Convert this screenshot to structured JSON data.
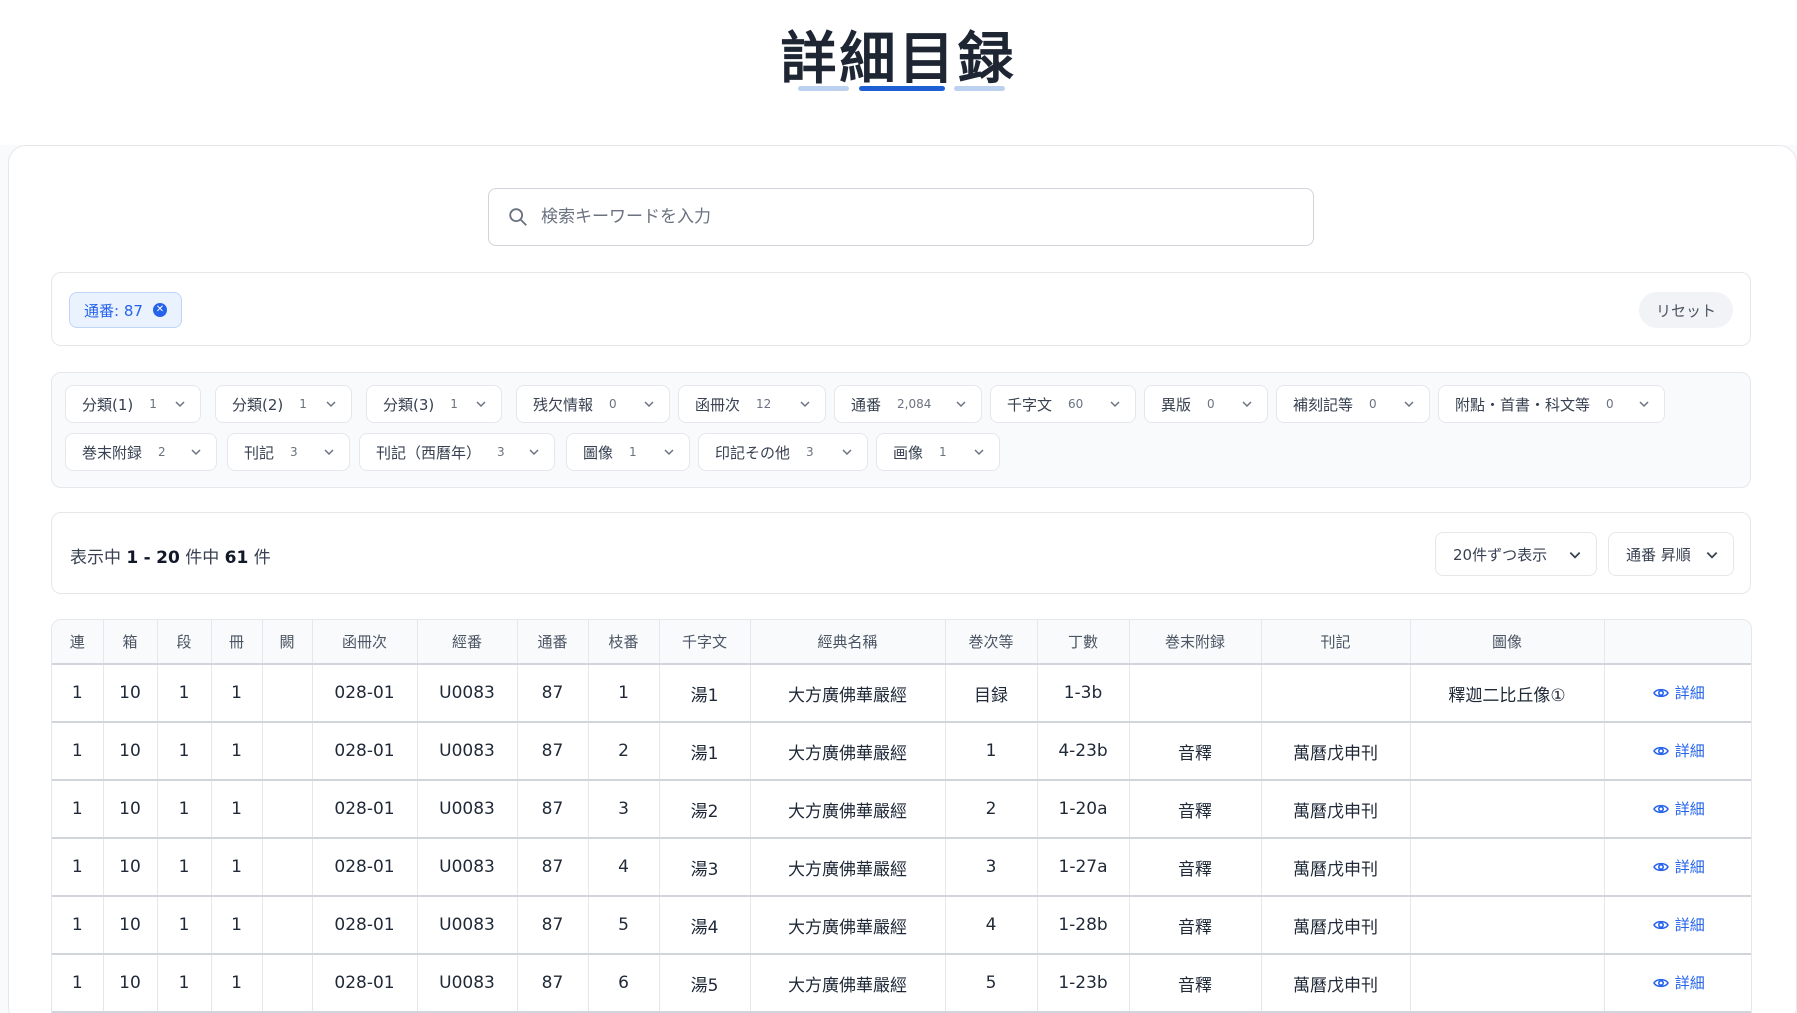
{
  "header": {
    "title": "詳細目録"
  },
  "search": {
    "placeholder": "検索キーワードを入力",
    "value": ""
  },
  "active_filters": {
    "chip_label": "通番: 87",
    "reset_label": "リセット"
  },
  "facets": [
    {
      "label": "分類(1)",
      "count": "1"
    },
    {
      "label": "分類(2)",
      "count": "1"
    },
    {
      "label": "分類(3)",
      "count": "1"
    },
    {
      "label": "残欠情報",
      "count": "0"
    },
    {
      "label": "函冊次",
      "count": "12"
    },
    {
      "label": "通番",
      "count": "2,084"
    },
    {
      "label": "千字文",
      "count": "60"
    },
    {
      "label": "異版",
      "count": "0"
    },
    {
      "label": "補刻記等",
      "count": "0"
    },
    {
      "label": "附點・首書・科文等",
      "count": "0"
    },
    {
      "label": "巻末附録",
      "count": "2"
    },
    {
      "label": "刊記",
      "count": "3"
    },
    {
      "label": "刊記（西曆年）",
      "count": "3"
    },
    {
      "label": "圖像",
      "count": "1"
    },
    {
      "label": "印記その他",
      "count": "3"
    },
    {
      "label": "画像",
      "count": "1"
    }
  ],
  "results": {
    "prefix": "表示中",
    "from": "1",
    "sep": "-",
    "to": "20",
    "mid": "件中",
    "total": "61",
    "suffix": "件",
    "per_page": "20件ずつ表示",
    "sort": "通番 昇順"
  },
  "table": {
    "columns": [
      "連",
      "箱",
      "段",
      "冊",
      "闕",
      "函冊次",
      "經番",
      "通番",
      "枝番",
      "千字文",
      "經典名稱",
      "巻次等",
      "丁數",
      "巻末附録",
      "刊記",
      "圖像",
      ""
    ],
    "detail_label": "詳細",
    "rows": [
      [
        "1",
        "10",
        "1",
        "1",
        "",
        "028-01",
        "U0083",
        "87",
        "1",
        "湯1",
        "大方廣佛華嚴經",
        "目録",
        "1-3b",
        "",
        "",
        "釋迦二比丘像①"
      ],
      [
        "1",
        "10",
        "1",
        "1",
        "",
        "028-01",
        "U0083",
        "87",
        "2",
        "湯1",
        "大方廣佛華嚴經",
        "1",
        "4-23b",
        "音釋",
        "萬曆戊申刊",
        ""
      ],
      [
        "1",
        "10",
        "1",
        "1",
        "",
        "028-01",
        "U0083",
        "87",
        "3",
        "湯2",
        "大方廣佛華嚴經",
        "2",
        "1-20a",
        "音釋",
        "萬曆戊申刊",
        ""
      ],
      [
        "1",
        "10",
        "1",
        "1",
        "",
        "028-01",
        "U0083",
        "87",
        "4",
        "湯3",
        "大方廣佛華嚴經",
        "3",
        "1-27a",
        "音釋",
        "萬曆戊申刊",
        ""
      ],
      [
        "1",
        "10",
        "1",
        "1",
        "",
        "028-01",
        "U0083",
        "87",
        "5",
        "湯4",
        "大方廣佛華嚴經",
        "4",
        "1-28b",
        "音釋",
        "萬曆戊申刊",
        ""
      ],
      [
        "1",
        "10",
        "1",
        "1",
        "",
        "028-01",
        "U0083",
        "87",
        "6",
        "湯5",
        "大方廣佛華嚴經",
        "5",
        "1-23b",
        "音釋",
        "萬曆戊申刊",
        ""
      ]
    ]
  },
  "colors": {
    "accent": "#2563eb",
    "title": "#1e2533",
    "bar_light": "#bcd0f0",
    "bar_dark": "#1f5fd4"
  }
}
